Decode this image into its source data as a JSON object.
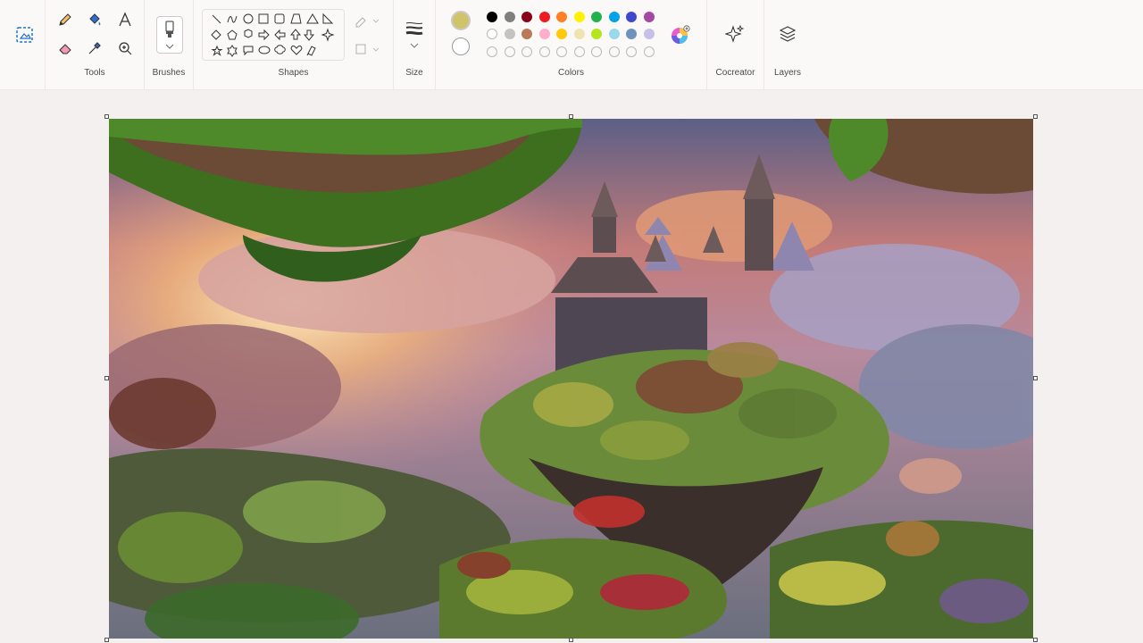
{
  "ribbon": {
    "groups": {
      "tools": "Tools",
      "brushes": "Brushes",
      "shapes": "Shapes",
      "size": "Size",
      "colors": "Colors",
      "cocreator": "Cocreator",
      "layers": "Layers"
    }
  },
  "colors": {
    "primary": "#cfc46a",
    "secondary": "#ffffff",
    "row1": [
      "#000000",
      "#7f7f7f",
      "#880015",
      "#ed1c24",
      "#ff7f27",
      "#fff200",
      "#22b14c",
      "#00a2e8",
      "#3f48cc",
      "#a349a4"
    ],
    "row2": [
      "#ffffff",
      "#c3c3c3",
      "#b97a57",
      "#ffaec9",
      "#ffc90e",
      "#efe4b0",
      "#b5e61d",
      "#99d9ea",
      "#7092be",
      "#c8bfe7"
    ],
    "row3_empty_count": 10
  },
  "icons": {
    "select": "image-select-icon",
    "pencil": "pencil-icon",
    "fill": "fill-bucket-icon",
    "text": "text-icon",
    "eraser": "eraser-icon",
    "picker": "color-picker-icon",
    "zoom": "magnifier-icon",
    "brush": "brush-icon",
    "size": "line-size-icon",
    "edit_colors": "color-wheel-icon",
    "cocreator": "sparkle-icon",
    "layers": "layers-icon"
  }
}
